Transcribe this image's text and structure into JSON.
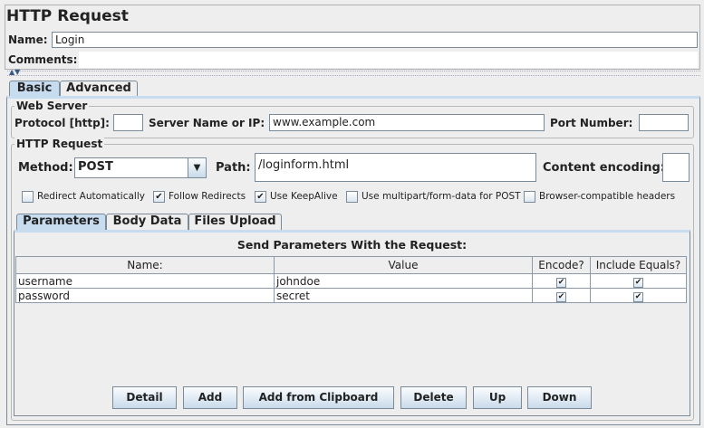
{
  "title": "HTTP Request",
  "name_label": "Name:",
  "name_value": "Login",
  "comments_label": "Comments:",
  "comments_value": "",
  "tabs": [
    {
      "label": "Basic",
      "selected": true
    },
    {
      "label": "Advanced",
      "selected": false
    }
  ],
  "web_server": {
    "legend": "Web Server",
    "protocol_label": "Protocol [http]:",
    "protocol_value": "",
    "server_label": "Server Name or IP:",
    "server_value": "www.example.com",
    "port_label": "Port Number:",
    "port_value": ""
  },
  "http_request": {
    "legend": "HTTP Request",
    "method_label": "Method:",
    "method_value": "POST",
    "path_label": "Path:",
    "path_value": "/loginform.html",
    "encoding_label": "Content encoding:",
    "encoding_value": ""
  },
  "checkboxes": [
    {
      "label": "Redirect Automatically",
      "checked": false
    },
    {
      "label": "Follow Redirects",
      "checked": true
    },
    {
      "label": "Use KeepAlive",
      "checked": true
    },
    {
      "label": "Use multipart/form-data for POST",
      "checked": false
    },
    {
      "label": "Browser-compatible headers",
      "checked": false
    }
  ],
  "inner_tabs": [
    {
      "label": "Parameters",
      "selected": true
    },
    {
      "label": "Body Data",
      "selected": false
    },
    {
      "label": "Files Upload",
      "selected": false
    }
  ],
  "params": {
    "title": "Send Parameters With the Request:",
    "columns": [
      "Name:",
      "Value",
      "Encode?",
      "Include Equals?"
    ],
    "rows": [
      {
        "name": "username",
        "value": "johndoe",
        "encode": true,
        "include_equals": true
      },
      {
        "name": "password",
        "value": "secret",
        "encode": true,
        "include_equals": true
      }
    ]
  },
  "buttons": [
    "Detail",
    "Add",
    "Add from Clipboard",
    "Delete",
    "Up",
    "Down"
  ],
  "colors": {
    "selected_tab": "#c8dcf0",
    "border": "#7a8a99"
  }
}
